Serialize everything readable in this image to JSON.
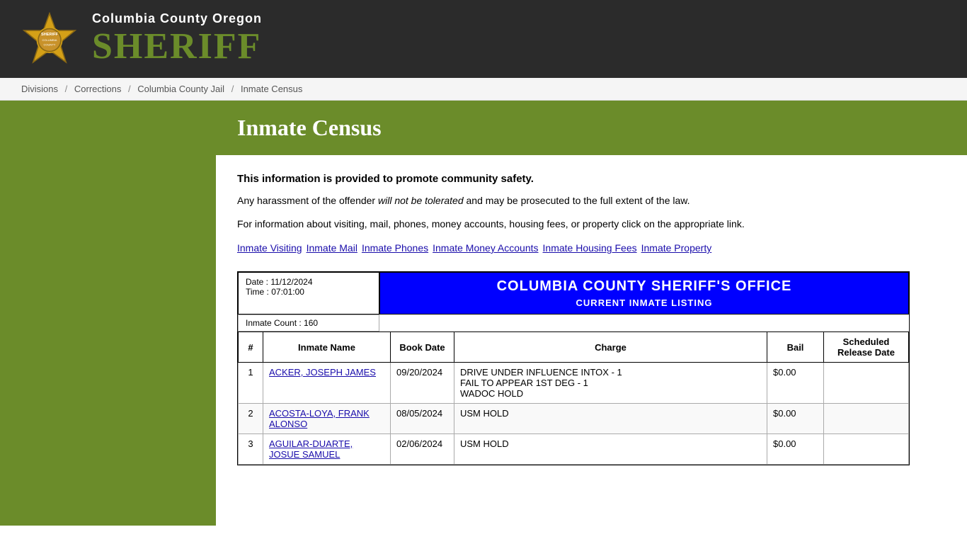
{
  "header": {
    "county_name": "Columbia County Oregon",
    "title": "Sheriff",
    "badge_alt": "Sheriff Badge"
  },
  "breadcrumb": {
    "items": [
      {
        "label": "Divisions",
        "href": "#"
      },
      {
        "label": "Corrections",
        "href": "#"
      },
      {
        "label": "Columbia County Jail",
        "href": "#"
      },
      {
        "label": "Inmate Census",
        "href": "#"
      }
    ]
  },
  "page": {
    "title": "Inmate Census",
    "info_bold": "This information is provided to promote community safety.",
    "info_text1": "Any harassment of the offender will not be tolerated and may be prosecuted to the full extent of the law.",
    "info_text1_italic": "will not be tolerated",
    "info_text2": "For information about visiting, mail, phones, money accounts, housing fees, or property click on the appropriate link.",
    "links": [
      {
        "label": "Inmate Visiting",
        "href": "#"
      },
      {
        "label": "Inmate Mail",
        "href": "#"
      },
      {
        "label": "Inmate Phones",
        "href": "#"
      },
      {
        "label": "Inmate Money Accounts",
        "href": "#"
      },
      {
        "label": "Inmate Housing Fees",
        "href": "#"
      },
      {
        "label": "Inmate Property",
        "href": "#"
      }
    ]
  },
  "table": {
    "date_label": "Date : 11/12/2024",
    "time_label": "Time : 07:01:00",
    "count_label": "Inmate Count : 160",
    "office_title": "COLUMBIA COUNTY SHERIFF'S OFFICE",
    "listing_subtitle": "CURRENT INMATE LISTING",
    "columns": {
      "num": "#",
      "name": "Inmate Name",
      "book_date": "Book Date",
      "charge": "Charge",
      "bail": "Bail",
      "release": "Scheduled Release Date"
    },
    "rows": [
      {
        "num": 1,
        "name": "ACKER, JOSEPH JAMES",
        "book_date": "09/20/2024",
        "charge": "DRIVE UNDER INFLUENCE INTOX - 1\nFAIL TO APPEAR 1ST DEG - 1\nWADOC HOLD",
        "bail": "$0.00",
        "release": ""
      },
      {
        "num": 2,
        "name": "ACOSTA-LOYA, FRANK ALONSO",
        "book_date": "08/05/2024",
        "charge": "USM HOLD",
        "bail": "$0.00",
        "release": ""
      },
      {
        "num": 3,
        "name": "AGUILAR-DUARTE, JOSUE SAMUEL",
        "book_date": "02/06/2024",
        "charge": "USM HOLD",
        "bail": "$0.00",
        "release": ""
      }
    ]
  }
}
